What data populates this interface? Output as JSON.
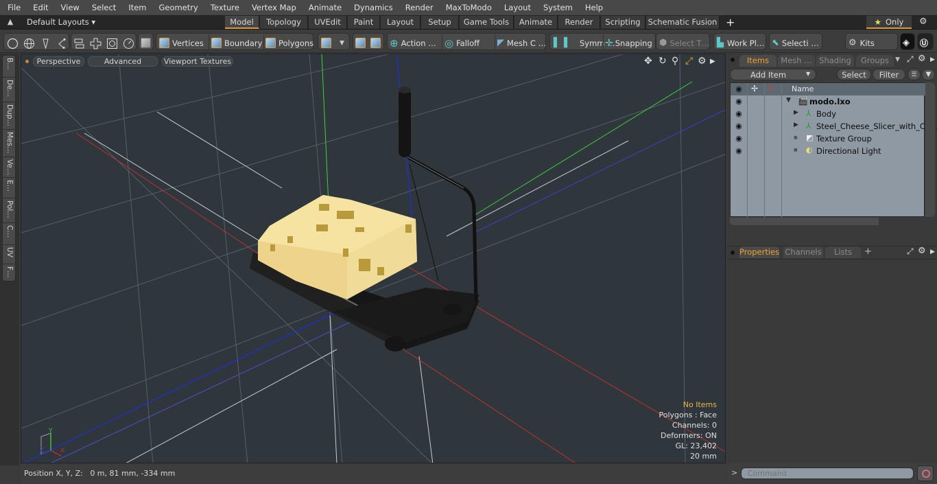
{
  "menubar": [
    "File",
    "Edit",
    "View",
    "Select",
    "Item",
    "Geometry",
    "Texture",
    "Vertex Map",
    "Animate",
    "Dynamics",
    "Render",
    "MaxToModo",
    "Layout",
    "System",
    "Help"
  ],
  "layoutbar": {
    "layout_select": "Default Layouts ▾",
    "tabs": [
      "Model",
      "Topology",
      "UVEdit",
      "Paint",
      "Layout",
      "Setup",
      "Game Tools",
      "Animate",
      "Render",
      "Scripting",
      "Schematic Fusion"
    ],
    "active_tab": "Model",
    "add_tab": "+",
    "only_label": "Only",
    "only_icon": "star-icon",
    "gear_icon": "gear-icon"
  },
  "toolbar": {
    "select_modes": [
      {
        "label": "Vertices",
        "icon": "vertices-cube-icon"
      },
      {
        "label": "Boundary",
        "icon": "boundary-cube-icon"
      },
      {
        "label": "Polygons",
        "icon": "polygons-cube-icon"
      }
    ],
    "action_label": "Action …",
    "falloff_label": "Falloff",
    "mesh_label": "Mesh C …",
    "symm_label": "Symm …",
    "snapping_label": "Snapping",
    "select_t_label": "Select T…",
    "workplane_label": "Work Pl…",
    "selecti_label": "Selecti …",
    "kits_label": "Kits"
  },
  "lefttabs": [
    "B…",
    "De…",
    "Dup…",
    "Mes…",
    "Ve…",
    "E…",
    "Pol…",
    "C…",
    "UV",
    "F…"
  ],
  "viewport": {
    "view_mode": "Perspective",
    "shading": "Advanced",
    "textures": "Viewport Textures",
    "info": {
      "selection": "No Items",
      "polygons": "Polygons : Face",
      "channels": "Channels: 0",
      "deformers": "Deformers: ON",
      "gl": "GL: 23,402",
      "scale": "20 mm"
    },
    "axis_labels": {
      "x": "X",
      "y": "Y",
      "z": "Z"
    },
    "colors": {
      "background": "#2f363c",
      "x_axis": "#c03030",
      "y_axis": "#40d040",
      "z_axis": "#2030d0",
      "cheese": "#f0d890",
      "metal": "#1c1c1c"
    }
  },
  "statusbar": {
    "position_label": "Position X, Y, Z:",
    "position_value": "0 m, 81 mm, -334 mm"
  },
  "items_panel": {
    "tabs": [
      "Items",
      "Mesh …",
      "Shading",
      "Groups"
    ],
    "active_tab": "Items",
    "add_item": "Add Item",
    "select_btn": "Select",
    "filter_btn": "Filter",
    "column_name": "Name",
    "tree": [
      {
        "label": "modo.lxo",
        "icon": "scene-clapper-icon",
        "bold": true,
        "depth": 0,
        "expand": "▼"
      },
      {
        "label": "Body",
        "icon": "mesh-locator-icon",
        "depth": 1,
        "expand": "▶"
      },
      {
        "label": "Steel_Cheese_Slicer_with_Ch…",
        "icon": "mesh-locator-icon",
        "depth": 1,
        "expand": "▶"
      },
      {
        "label": "Texture Group",
        "icon": "texture-group-icon",
        "depth": 1,
        "expand": ""
      },
      {
        "label": "Directional Light",
        "icon": "directional-light-icon",
        "depth": 1,
        "expand": ""
      }
    ]
  },
  "properties_panel": {
    "tabs": [
      "Properties",
      "Channels",
      "Lists"
    ],
    "active_tab": "Properties",
    "add_tab": "+"
  },
  "command": {
    "prompt": ">",
    "placeholder": "Command"
  },
  "accent_color": "#e09a3a"
}
